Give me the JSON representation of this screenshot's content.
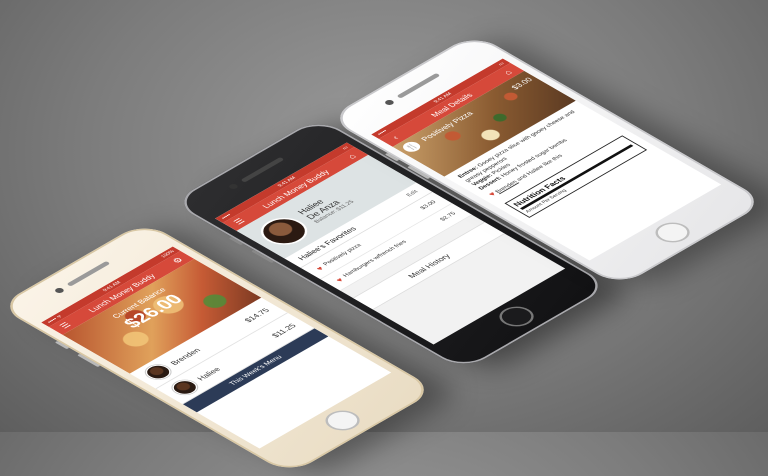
{
  "phone1": {
    "status_left": "••••• ᯤ",
    "status_time": "9:41 AM",
    "status_right": "100%",
    "nav_title": "Lunch Money Buddy",
    "balance_label": "Current Balance",
    "balance_amount": "$26.00",
    "kids": [
      {
        "name": "Brenden",
        "amount": "$14.75"
      },
      {
        "name": "Haliee",
        "amount": "$11.25"
      }
    ],
    "weekly_menu_label": "This Week's Menu"
  },
  "phone2": {
    "status_time": "9:41 AM",
    "nav_title": "Lunch Money Buddy",
    "profile_name_line1": "Haliee",
    "profile_name_line2": "De Anza",
    "profile_balance": "Balance: $11.25",
    "favorites_title": "Haliee's Favorites",
    "edit_label": "Edit",
    "favorites": [
      {
        "name": "Positively pizza",
        "price": "$3.00"
      },
      {
        "name": "Hamburgers w/french fries",
        "price": "$2.75"
      }
    ],
    "meal_history_label": "Meal History"
  },
  "phone3": {
    "status_time": "9:41 AM",
    "nav_title": "Meal Details",
    "meal_name": "Positively Pizza",
    "meal_price": "$3.00",
    "entree_label": "Entree:",
    "entree_text": "Gooey pizza slice with gooey cheese and greasy pepperoni",
    "veggie_label": "Veggie:",
    "veggie_text": "Pickles",
    "dessert_label": "Dessert:",
    "dessert_text": "Honey frosted sugar bombs",
    "likes_name": "Brenden",
    "likes_text": "and Haliee like this",
    "nutrition_title": "Nutrition Facts",
    "nutrition_sub": "Amount Per Serving"
  },
  "colors": {
    "accent": "#d6493a",
    "status": "#c43a2c",
    "navy": "#2c3b57"
  }
}
